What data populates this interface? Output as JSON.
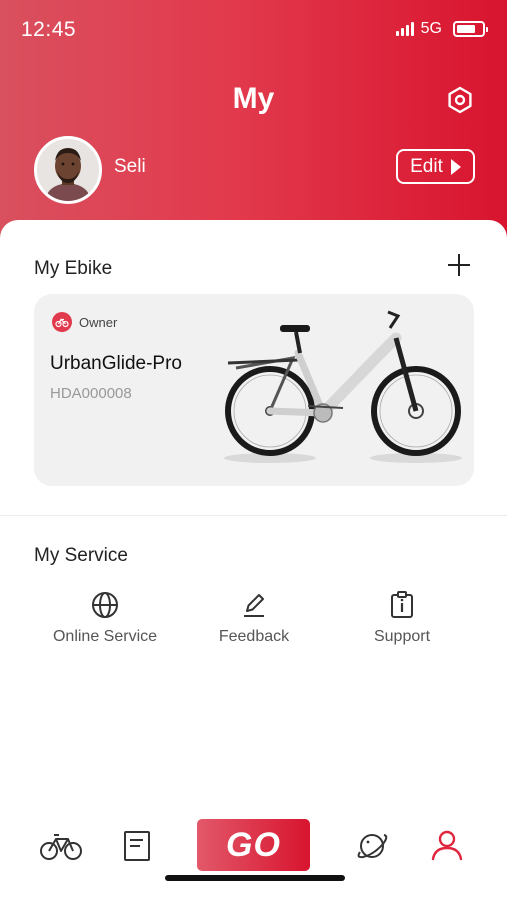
{
  "status_bar": {
    "time": "12:45",
    "network": "5G",
    "icons": [
      "signal-icon",
      "battery-icon"
    ]
  },
  "header": {
    "title": "My",
    "settings_icon": "settings-hexagon-icon",
    "user_name": "Seli",
    "edit_label": "Edit"
  },
  "ebike": {
    "section_title": "My Ebike",
    "add_icon": "plus-icon",
    "card": {
      "role": "Owner",
      "name": "UrbanGlide-Pro",
      "serial": "HDA000008"
    }
  },
  "service": {
    "section_title": "My Service",
    "items": [
      {
        "label": "Online Service",
        "icon": "globe-icon"
      },
      {
        "label": "Feedback",
        "icon": "pen-icon"
      },
      {
        "label": "Support",
        "icon": "clipboard-info-icon"
      }
    ]
  },
  "bottom_nav": {
    "go_label": "GO",
    "items": [
      "bike-icon",
      "document-icon",
      "go-button",
      "planet-icon",
      "profile-icon"
    ],
    "active": "profile-icon"
  },
  "colors": {
    "accent": "#E0253E",
    "header_gradient_start": "#D9505E",
    "header_gradient_end": "#D8142E"
  }
}
